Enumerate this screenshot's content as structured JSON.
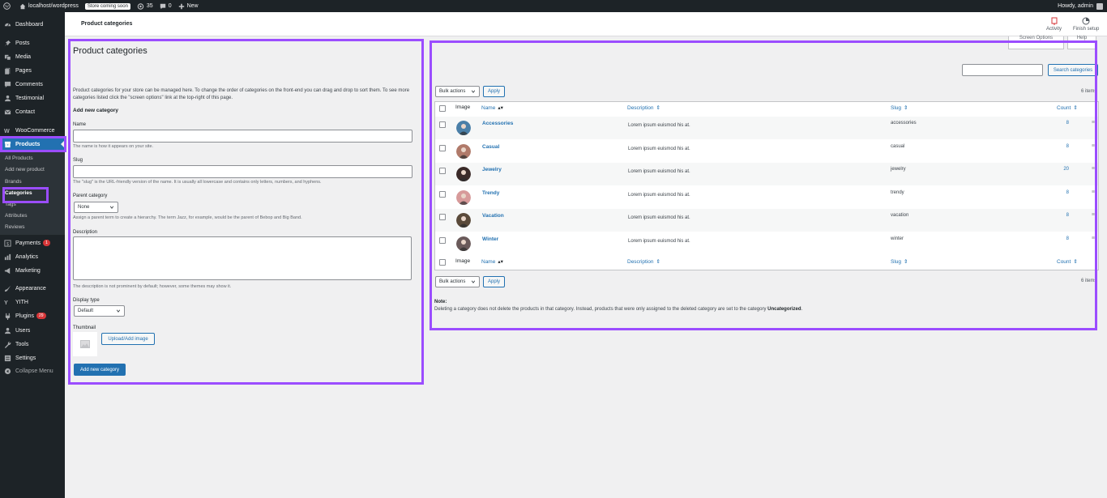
{
  "adminbar": {
    "site": "localhost/wordpress",
    "store_badge": "Store coming soon",
    "updates": "35",
    "comments": "0",
    "new": "New",
    "howdy": "Howdy, admin"
  },
  "sidebar": {
    "items": [
      {
        "label": "Dashboard",
        "icon": "dashboard-icon"
      },
      {
        "label": "Posts",
        "icon": "pin-icon"
      },
      {
        "label": "Media",
        "icon": "media-icon"
      },
      {
        "label": "Pages",
        "icon": "pages-icon"
      },
      {
        "label": "Comments",
        "icon": "comment-icon"
      },
      {
        "label": "Testimonial",
        "icon": "person-icon"
      },
      {
        "label": "Contact",
        "icon": "mail-icon"
      },
      {
        "label": "WooCommerce",
        "icon": "woo-icon"
      },
      {
        "label": "Products",
        "icon": "archive-icon"
      },
      {
        "label": "Payments",
        "icon": "payments-icon",
        "badge": "1"
      },
      {
        "label": "Analytics",
        "icon": "chart-icon"
      },
      {
        "label": "Marketing",
        "icon": "megaphone-icon"
      },
      {
        "label": "Appearance",
        "icon": "brush-icon"
      },
      {
        "label": "YITH",
        "icon": "yith-icon"
      },
      {
        "label": "Plugins",
        "icon": "plug-icon",
        "badge": "29"
      },
      {
        "label": "Users",
        "icon": "users-icon"
      },
      {
        "label": "Tools",
        "icon": "wrench-icon"
      },
      {
        "label": "Settings",
        "icon": "settings-icon"
      },
      {
        "label": "Collapse Menu",
        "icon": "collapse-icon"
      }
    ],
    "submenu": [
      "All Products",
      "Add new product",
      "Brands",
      "Categories",
      "Tags",
      "Attributes",
      "Reviews"
    ]
  },
  "header": {
    "title": "Product categories",
    "activity": "Activity",
    "finish_setup": "Finish setup",
    "screen_options": "Screen Options",
    "help": "Help"
  },
  "form": {
    "heading": "Product categories",
    "intro": "Product categories for your store can be managed here. To change the order of categories on the front-end you can drag and drop to sort them. To see more categories listed click the \"screen options\" link at the top-right of this page.",
    "add_new": "Add new category",
    "name_label": "Name",
    "name_help": "The name is how it appears on your site.",
    "slug_label": "Slug",
    "slug_help": "The \"slug\" is the URL-friendly version of the name. It is usually all lowercase and contains only letters, numbers, and hyphens.",
    "parent_label": "Parent category",
    "parent_value": "None",
    "parent_help": "Assign a parent term to create a hierarchy. The term Jazz, for example, would be the parent of Bebop and Big Band.",
    "description_label": "Description",
    "description_help": "The description is not prominent by default; however, some themes may show it.",
    "display_label": "Display type",
    "display_value": "Default",
    "thumbnail_label": "Thumbnail",
    "upload_button": "Upload/Add image",
    "submit_button": "Add new category"
  },
  "list": {
    "search_button": "Search categories",
    "bulk_actions": "Bulk actions",
    "apply": "Apply",
    "items_count": "6 items",
    "columns": {
      "image": "Image",
      "name": "Name",
      "description": "Description",
      "slug": "Slug",
      "count": "Count"
    },
    "rows": [
      {
        "name": "Accessories",
        "description": "Lorem ipsum euismod his at.",
        "slug": "accessories",
        "count": "8",
        "color": "#4a7fa8"
      },
      {
        "name": "Casual",
        "description": "Lorem ipsum euismod his at.",
        "slug": "casual",
        "count": "8",
        "color": "#b07a6a"
      },
      {
        "name": "Jewelry",
        "description": "Lorem ipsum euismod his at.",
        "slug": "jewelry",
        "count": "20",
        "color": "#3a2a28"
      },
      {
        "name": "Trendy",
        "description": "Lorem ipsum euismod his at.",
        "slug": "trendy",
        "count": "8",
        "color": "#d79a9a"
      },
      {
        "name": "Vacation",
        "description": "Lorem ipsum euismod his at.",
        "slug": "vacation",
        "count": "8",
        "color": "#5a4a3a"
      },
      {
        "name": "Winter",
        "description": "Lorem ipsum euismod his at.",
        "slug": "winter",
        "count": "8",
        "color": "#6a5a5a"
      }
    ],
    "note_label": "Note:",
    "note_text": "Deleting a category does not delete the products in that category. Instead, products that were only assigned to the deleted category are set to the category",
    "note_bold": "Uncategorized",
    "note_end": "."
  },
  "colors": {
    "highlight": "#9b4dff",
    "accent": "#2271b1",
    "sidebar": "#1d2327"
  }
}
